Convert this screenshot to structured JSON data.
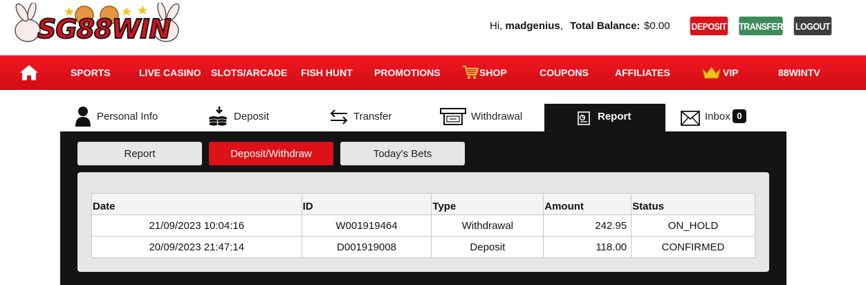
{
  "header": {
    "logo_text": "SG88WIN",
    "greeting_prefix": "Hi,",
    "username": "madgenius",
    "greeting_suffix": ",",
    "balance_label": "Total Balance:",
    "balance_value": "$0.00",
    "deposit_label": "DEPOSIT",
    "transfer_label": "TRANSFER",
    "logout_label": "LOGOUT"
  },
  "nav": {
    "home_icon": "home-icon",
    "items": [
      {
        "label": "SPORTS"
      },
      {
        "label": "LIVE CASINO"
      },
      {
        "label": "SLOTS/ARCADE"
      },
      {
        "label": "FISH HUNT"
      },
      {
        "label": "PROMOTIONS"
      },
      {
        "label": "SHOP",
        "icon": "shopping-cart-icon"
      },
      {
        "label": "COUPONS"
      },
      {
        "label": "AFFILIATES"
      },
      {
        "label": "VIP",
        "icon": "crown-icon"
      },
      {
        "label": "88WINTV"
      }
    ]
  },
  "tabs": [
    {
      "label": "Personal Info",
      "icon": "person-icon"
    },
    {
      "label": "Deposit",
      "icon": "coins-icon"
    },
    {
      "label": "Transfer",
      "icon": "transfer-arrows-icon"
    },
    {
      "label": "Withdrawal",
      "icon": "cash-withdraw-icon"
    },
    {
      "label": "Report",
      "icon": "report-icon",
      "active": true
    },
    {
      "label": "Inbox",
      "icon": "envelope-icon",
      "badge": "0"
    }
  ],
  "subtabs": [
    {
      "label": "Report"
    },
    {
      "label": "Deposit/Withdraw",
      "active": true
    },
    {
      "label": "Today's Bets"
    }
  ],
  "table": {
    "headers": [
      "Date",
      "ID",
      "Type",
      "Amount",
      "Status"
    ],
    "rows": [
      [
        "21/09/2023 10:04:16",
        "W001919464",
        "Withdrawal",
        "242.95",
        "ON_HOLD"
      ],
      [
        "20/09/2023 21:47:14",
        "D001919008",
        "Deposit",
        "118.00",
        "CONFIRMED"
      ]
    ]
  },
  "colors": {
    "brand_red": "#dc1218",
    "transfer_green": "#3d8a5a",
    "logout_dark": "#3d3d3d",
    "panel_dark": "#141414"
  }
}
